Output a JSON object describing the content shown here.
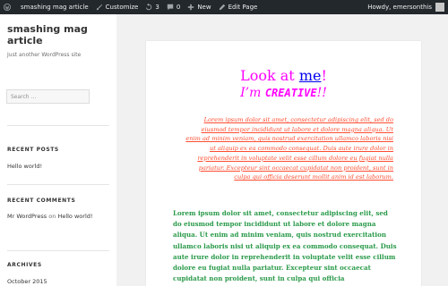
{
  "adminbar": {
    "site_name": "smashing mag article",
    "customize_label": "Customize",
    "updates_count": "3",
    "comments_count": "0",
    "new_label": "New",
    "edit_page_label": "Edit Page",
    "howdy_label": "Howdy, emersonthis"
  },
  "sidebar": {
    "site_title": "smashing mag article",
    "tagline": "Just another WordPress site",
    "search_placeholder": "Search …",
    "recent_posts": {
      "title": "RECENT POSTS",
      "items": [
        "Hello world!"
      ]
    },
    "recent_comments": {
      "title": "RECENT COMMENTS",
      "author": "Mr WordPress",
      "on_text": "on",
      "post": "Hello world!"
    },
    "archives": {
      "title": "ARCHIVES",
      "items": [
        "October 2015"
      ]
    }
  },
  "content": {
    "heading1_prefix": "Look at ",
    "heading1_link": "me",
    "heading1_suffix": "!",
    "heading2_prefix": "I’m ",
    "heading2_creative": "CREATIVE",
    "heading2_suffix": "!!",
    "paragraph_orange": "Lorem ipsum dolor sit amet, consectetur adipiscing elit, sed do eiusmod tempor incididunt ut labore et dolore magna aliqua. Ut enim ad minim veniam, quis nostrud exercitation ullamco laboris nisi ut aliquip ex ea commodo consequat. Duis aute irure dolor in reprehenderit in voluptate velit esse cillum dolore eu fugiat nulla pariatur. Excepteur sint occaecat cupidatat non proident, sunt in culpa qui officia deserunt mollit anim id est laborum.",
    "paragraph_green": "Lorem ipsum dolor sit amet, consectetur adipiscing elit, sed do eiusmod tempor incididunt ut labore et dolore magna aliqua. Ut enim ad minim veniam, quis nostrud exercitation ullamco laboris nisi ut aliquip ex ea commodo consequat. Duis aute irure dolor in reprehenderit in voluptate velit esse cillum dolore eu fugiat nulla pariatur. Excepteur sint occaecat cupidatat non proident, sunt in culpa qui officia"
  },
  "colors": {
    "adminbar_bg": "#23282d",
    "heading_magenta": "#ff00ff",
    "link_blue": "#0000ee",
    "orange_text": "#ff4d30",
    "green_text": "#2a9a4a"
  },
  "icons": [
    "wordpress-icon",
    "customize-brush-icon",
    "updates-icon",
    "comments-icon",
    "plus-icon",
    "edit-pencil-icon",
    "avatar"
  ]
}
